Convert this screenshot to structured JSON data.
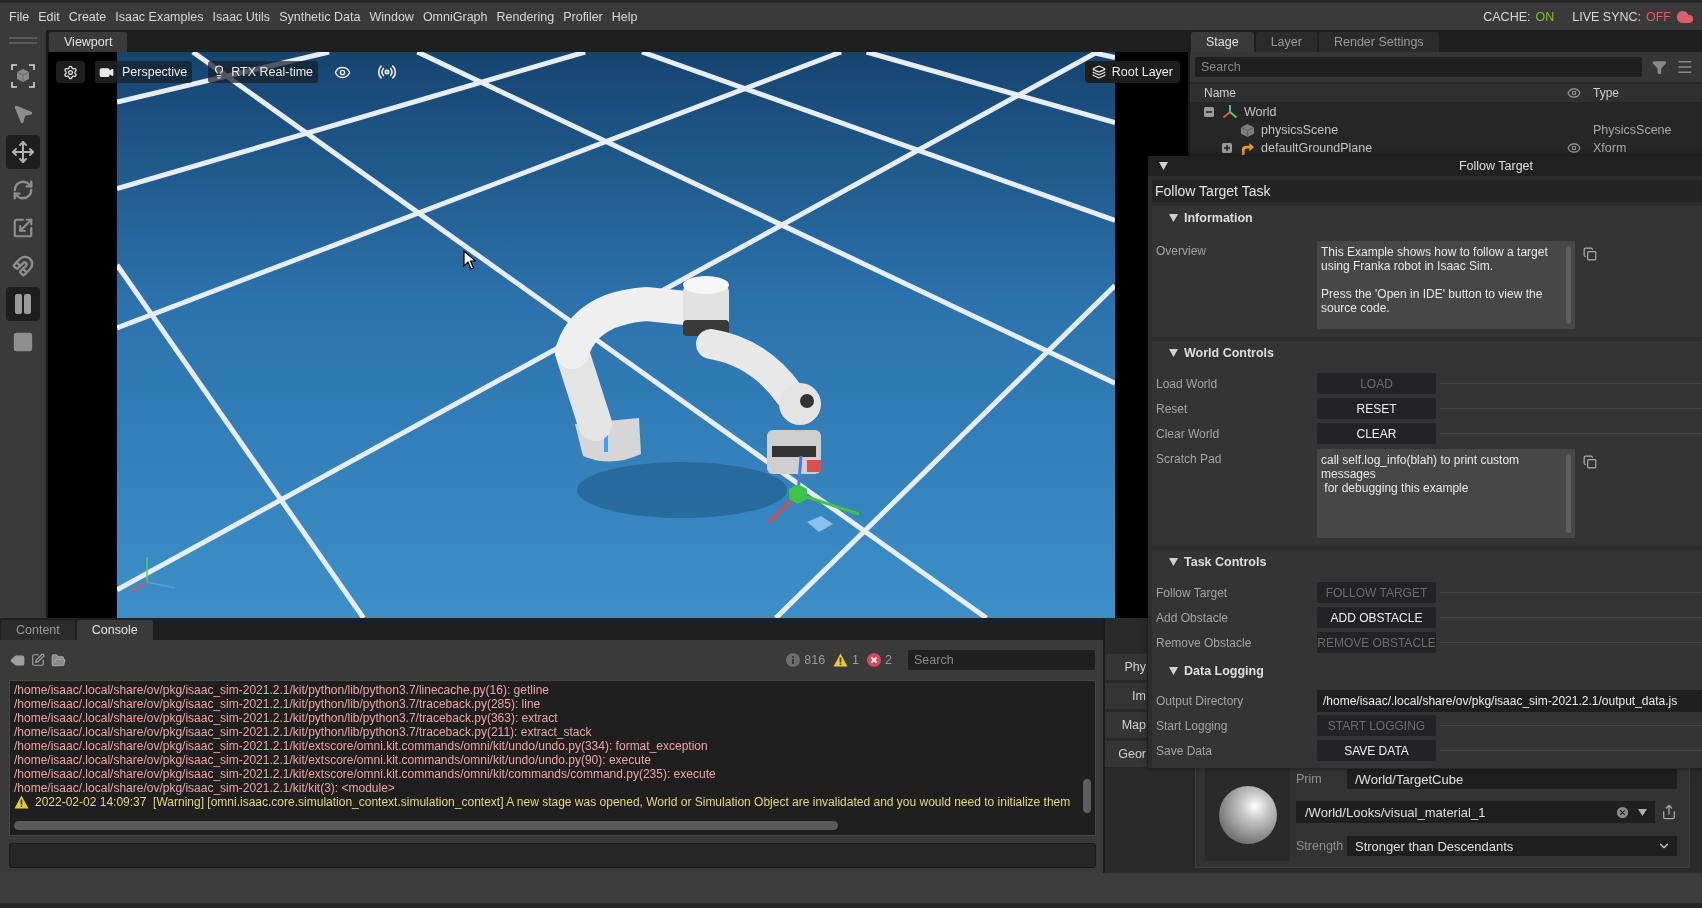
{
  "menu_bar": {
    "items": [
      "File",
      "Edit",
      "Create",
      "Isaac Examples",
      "Isaac Utils",
      "Synthetic Data",
      "Window",
      "OmniGraph",
      "Rendering",
      "Profiler",
      "Help"
    ],
    "status": [
      {
        "kind": "cache",
        "label": "CACHE:",
        "value": "ON",
        "on": true
      },
      {
        "kind": "live-sync",
        "label": "LIVE SYNC:",
        "value": "OFF",
        "on": false
      }
    ]
  },
  "toolbar": {
    "tools": [
      {
        "kind": "frame",
        "selected": false
      },
      {
        "kind": "pointer",
        "selected": false
      },
      {
        "kind": "move",
        "selected": true
      },
      {
        "kind": "rotate",
        "selected": false
      },
      {
        "kind": "scale",
        "selected": false
      },
      {
        "kind": "snap",
        "selected": false
      },
      {
        "kind": "pause",
        "selected": true
      },
      {
        "kind": "stop",
        "selected": false
      }
    ]
  },
  "viewport": {
    "tabs": [
      {
        "label": "Viewport",
        "selected": true
      }
    ],
    "camera": "Perspective",
    "renderer": "RTX Real-time",
    "layer": "Root Layer"
  },
  "stage": {
    "tabs": [
      {
        "label": "Stage",
        "selected": true
      },
      {
        "label": "Layer",
        "selected": false
      },
      {
        "label": "Render Settings",
        "selected": false
      }
    ],
    "search": {
      "placeholder": "Search"
    },
    "columns": [
      "Name",
      "Type"
    ],
    "tree": [
      {
        "name": "World",
        "kind": "scope",
        "expanded": true,
        "visible": false,
        "children": [
          {
            "name": "physicsScene",
            "kind": "physics",
            "type": "PhysicsScene",
            "visible": false
          },
          {
            "name": "defaultGroundPlane",
            "kind": "xform",
            "type": "Xform",
            "expanded": false,
            "visible": true
          }
        ]
      }
    ]
  },
  "follow_target": {
    "title": "Follow Target",
    "task_title": "Follow Target Task",
    "sections": [
      {
        "title": "Information",
        "expanded": true,
        "rows": [
          {
            "kind": "text",
            "label": "Overview",
            "value": "This Example shows how to follow a target using Franka robot in Isaac Sim.\n\nPress the 'Open in IDE' button to view the source code."
          }
        ]
      },
      {
        "title": "World Controls",
        "expanded": true,
        "rows": [
          {
            "kind": "button",
            "label": "Load World",
            "button": "LOAD",
            "disabled": true
          },
          {
            "kind": "button",
            "label": "Reset",
            "button": "RESET",
            "disabled": false
          },
          {
            "kind": "button",
            "label": "Clear World",
            "button": "CLEAR",
            "disabled": false
          },
          {
            "kind": "text",
            "label": "Scratch Pad",
            "value": "call self.log_info(blah) to print custom messages\n for debugging this example"
          }
        ]
      },
      {
        "title": "Task Controls",
        "expanded": true,
        "rows": [
          {
            "kind": "button",
            "label": "Follow Target",
            "button": "FOLLOW TARGET",
            "disabled": true
          },
          {
            "kind": "button",
            "label": "Add Obstacle",
            "button": "ADD OBSTACLE",
            "disabled": false
          },
          {
            "kind": "button",
            "label": "Remove Obstacle",
            "button": "REMOVE OBSTACLE",
            "disabled": true
          }
        ],
        "sections": [
          {
            "title": "Data Logging",
            "expanded": true,
            "rows": [
              {
                "kind": "field",
                "label": "Output Directory",
                "value": "/home/isaac/.local/share/ov/pkg/isaac_sim-2021.2.1/output_data.js"
              },
              {
                "kind": "button",
                "label": "Start Logging",
                "button": "START LOGGING",
                "disabled": true
              },
              {
                "kind": "button",
                "label": "Save Data",
                "button": "SAVE DATA",
                "disabled": false
              }
            ]
          }
        ]
      }
    ]
  },
  "console": {
    "tabs": [
      {
        "label": "Content",
        "selected": false
      },
      {
        "label": "Console",
        "selected": true
      }
    ],
    "counts": [
      {
        "kind": "info",
        "value": "816"
      },
      {
        "kind": "warning",
        "value": "1"
      },
      {
        "kind": "error",
        "value": "2"
      }
    ],
    "search": {
      "placeholder": "Search"
    },
    "lines": [
      {
        "kind": "error",
        "text": "/home/isaac/.local/share/ov/pkg/isaac_sim-2021.2.1/kit/python/lib/python3.7/linecache.py(16): getline"
      },
      {
        "kind": "error",
        "text": "/home/isaac/.local/share/ov/pkg/isaac_sim-2021.2.1/kit/python/lib/python3.7/traceback.py(285): line"
      },
      {
        "kind": "error",
        "text": "/home/isaac/.local/share/ov/pkg/isaac_sim-2021.2.1/kit/python/lib/python3.7/traceback.py(363): extract"
      },
      {
        "kind": "error",
        "text": "/home/isaac/.local/share/ov/pkg/isaac_sim-2021.2.1/kit/python/lib/python3.7/traceback.py(211): extract_stack"
      },
      {
        "kind": "error",
        "text": "/home/isaac/.local/share/ov/pkg/isaac_sim-2021.2.1/kit/extscore/omni.kit.commands/omni/kit/undo/undo.py(334): format_exception"
      },
      {
        "kind": "error",
        "text": "/home/isaac/.local/share/ov/pkg/isaac_sim-2021.2.1/kit/extscore/omni.kit.commands/omni/kit/undo/undo.py(90): execute"
      },
      {
        "kind": "error",
        "text": "/home/isaac/.local/share/ov/pkg/isaac_sim-2021.2.1/kit/extscore/omni.kit.commands/omni/kit/commands/command.py(235): execute"
      },
      {
        "kind": "error",
        "text": "/home/isaac/.local/share/ov/pkg/isaac_sim-2021.2.1/kit/kit(3): <module>"
      },
      {
        "kind": "warning",
        "text": "2022-02-02 14:09:37  [Warning] [omni.isaac.core.simulation_context.simulation_context] A new stage was opened, World or Simulation Object are invalidated and you would need to initialize them"
      }
    ]
  },
  "property": {
    "side_buttons": [
      "Phy",
      "Im",
      "Map",
      "Geor"
    ],
    "material": {
      "prim_label": "Prim",
      "prim": "/World/TargetCube",
      "path": "/World/Looks/visual_material_1",
      "strength_label": "Strength",
      "strength": "Stronger than Descendants"
    }
  }
}
